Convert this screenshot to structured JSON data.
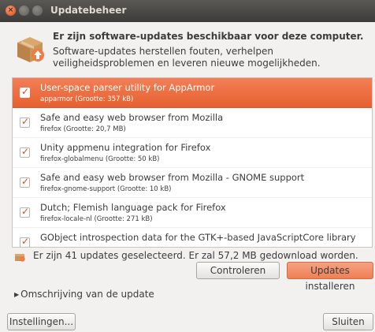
{
  "window": {
    "title": "Updatebeheer",
    "close_glyph": "×"
  },
  "header": {
    "icon": "package-update-icon",
    "title": "Er zijn software-updates beschikbaar voor deze computer.",
    "description": "Software-updates herstellen fouten, verhelpen veiligheidsproblemen en leveren nieuwe mogelijkheden."
  },
  "updates": [
    {
      "title": "User-space parser utility for AppArmor",
      "subtitle": "apparmor (Grootte: 357 kB)",
      "checked": true,
      "selected": true
    },
    {
      "title": "Safe and easy web browser from Mozilla",
      "subtitle": "firefox (Grootte: 20,7 MB)",
      "checked": true,
      "selected": false
    },
    {
      "title": "Unity appmenu integration for Firefox",
      "subtitle": "firefox-globalmenu (Grootte: 50 kB)",
      "checked": true,
      "selected": false
    },
    {
      "title": "Safe and easy web browser from Mozilla - GNOME support",
      "subtitle": "firefox-gnome-support (Grootte: 10 kB)",
      "checked": true,
      "selected": false
    },
    {
      "title": "Dutch; Flemish language pack for Firefox",
      "subtitle": "firefox-locale-nl (Grootte: 271 kB)",
      "checked": true,
      "selected": false
    },
    {
      "title": "GObject introspection data for the GTK+-based JavaScriptCore library",
      "subtitle": "",
      "checked": true,
      "selected": false
    }
  ],
  "status": {
    "text": "Er zijn 41 updates geselecteerd. Er zal 57,2 MB gedownload worden."
  },
  "buttons": {
    "check": "Controleren",
    "install": "Updates installeren",
    "settings": "Instellingen...",
    "close": "Sluiten"
  },
  "expander": {
    "arrow": "▶",
    "label": "Omschrijving van de update"
  },
  "colors": {
    "accent": "#dd4814",
    "selection": "#e9683a",
    "titlebar": "#3c3b37",
    "background": "#f2f1f0"
  }
}
